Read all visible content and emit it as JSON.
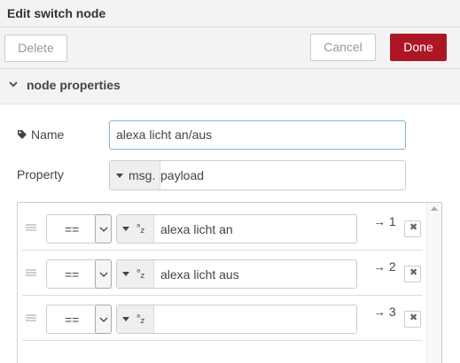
{
  "dialog": {
    "title": "Edit switch node"
  },
  "buttons": {
    "delete": "Delete",
    "cancel": "Cancel",
    "done": "Done"
  },
  "section": {
    "title": "node properties"
  },
  "fields": {
    "name_label": "Name",
    "name_value": "alexa licht an/aus",
    "property_label": "Property",
    "property_type": "msg.",
    "property_value": "payload"
  },
  "rules": [
    {
      "operator": "==",
      "type_icon": "az-string-icon",
      "value": "alexa licht an",
      "output": "→ 1"
    },
    {
      "operator": "==",
      "type_icon": "az-string-icon",
      "value": "alexa licht aus",
      "output": "→ 2"
    },
    {
      "operator": "==",
      "type_icon": "az-string-icon",
      "value": "",
      "output": "→ 3"
    }
  ],
  "colors": {
    "done_button": "#ad1625",
    "focus_border": "#7fb4d6"
  }
}
